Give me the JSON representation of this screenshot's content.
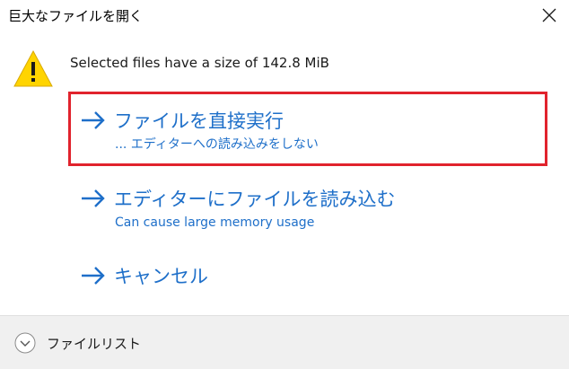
{
  "window": {
    "title": "巨大なファイルを開く",
    "close_icon": "close-icon"
  },
  "content": {
    "icon": "warning-icon",
    "message": "Selected files have a size of 142.8 MiB"
  },
  "commands": [
    {
      "icon": "arrow-right-icon",
      "label": "ファイルを直接実行",
      "sublabel": "... エディターへの読み込みをしない",
      "highlighted": true
    },
    {
      "icon": "arrow-right-icon",
      "label": "エディターにファイルを読み込む",
      "sublabel": "Can cause large memory usage",
      "highlighted": false
    },
    {
      "icon": "arrow-right-icon",
      "label": "キャンセル",
      "sublabel": "",
      "highlighted": false
    }
  ],
  "footer": {
    "icon": "chevron-down-circle-icon",
    "label": "ファイルリスト"
  },
  "colors": {
    "link": "#1e6fc9",
    "highlight_border": "#e1232d",
    "warning_fill": "#ffd400",
    "footer_bg": "#f0f0f0"
  }
}
